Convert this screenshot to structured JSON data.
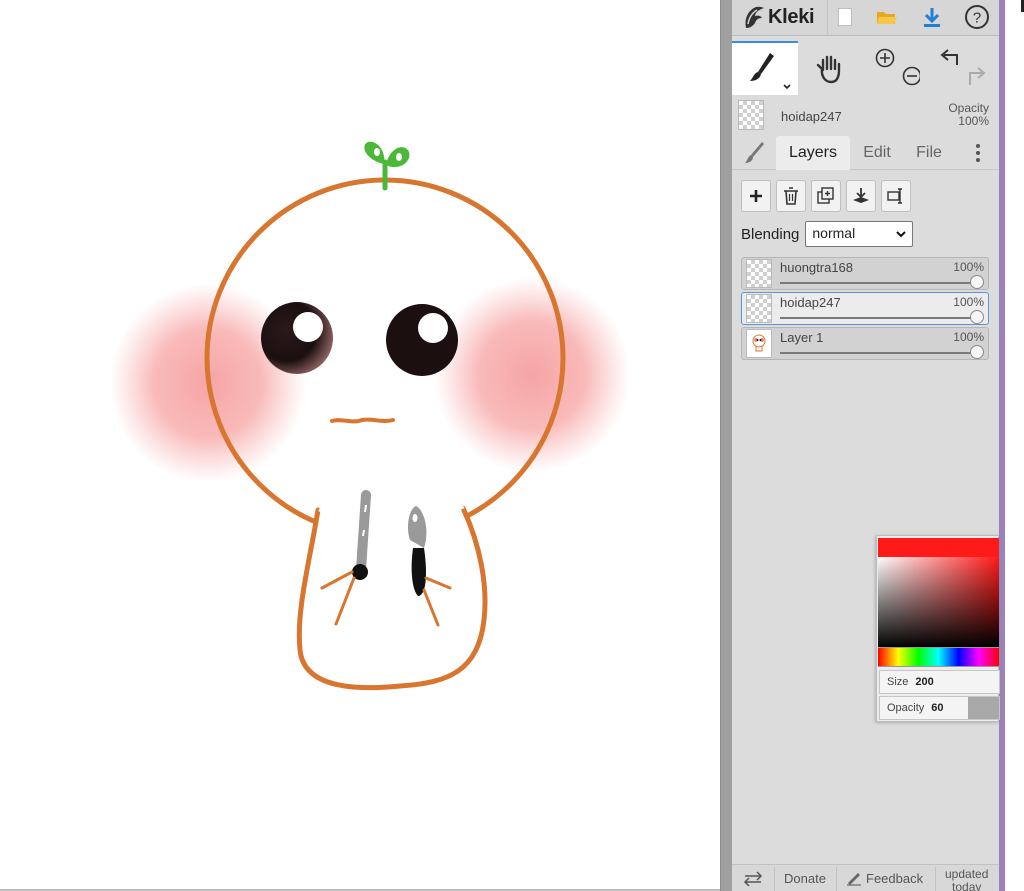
{
  "app": {
    "name": "Kleki"
  },
  "active_layer": {
    "name": "hoidap247",
    "opacity_label": "Opacity",
    "opacity_value": "100%"
  },
  "tabs": [
    {
      "label": "Layers",
      "active": true
    },
    {
      "label": "Edit",
      "active": false
    },
    {
      "label": "File",
      "active": false
    }
  ],
  "blending": {
    "label": "Blending",
    "value": "normal"
  },
  "layers": [
    {
      "name": "huongtra168",
      "opacity": "100%",
      "selected": false
    },
    {
      "name": "hoidap247",
      "opacity": "100%",
      "selected": true
    },
    {
      "name": "Layer 1",
      "opacity": "100%",
      "selected": false
    }
  ],
  "color_picker": {
    "current_color": "#ff1a1a",
    "size_label": "Size",
    "size_value": "200",
    "opacity_label": "Opacity",
    "opacity_value": "60"
  },
  "footer": {
    "donate": "Donate",
    "feedback": "Feedback",
    "updated_line1": "updated",
    "updated_line2": "today"
  },
  "icons": [
    "kleki-logo-icon",
    "new-image-icon",
    "open-folder-icon",
    "download-icon",
    "help-icon",
    "brush-icon",
    "hand-icon",
    "zoom-in-icon",
    "zoom-out-icon",
    "undo-icon",
    "redo-icon",
    "add-layer-icon",
    "delete-layer-icon",
    "duplicate-layer-icon",
    "merge-down-icon",
    "rename-layer-icon",
    "more-vertical-icon",
    "swap-icon",
    "feedback-icon"
  ]
}
